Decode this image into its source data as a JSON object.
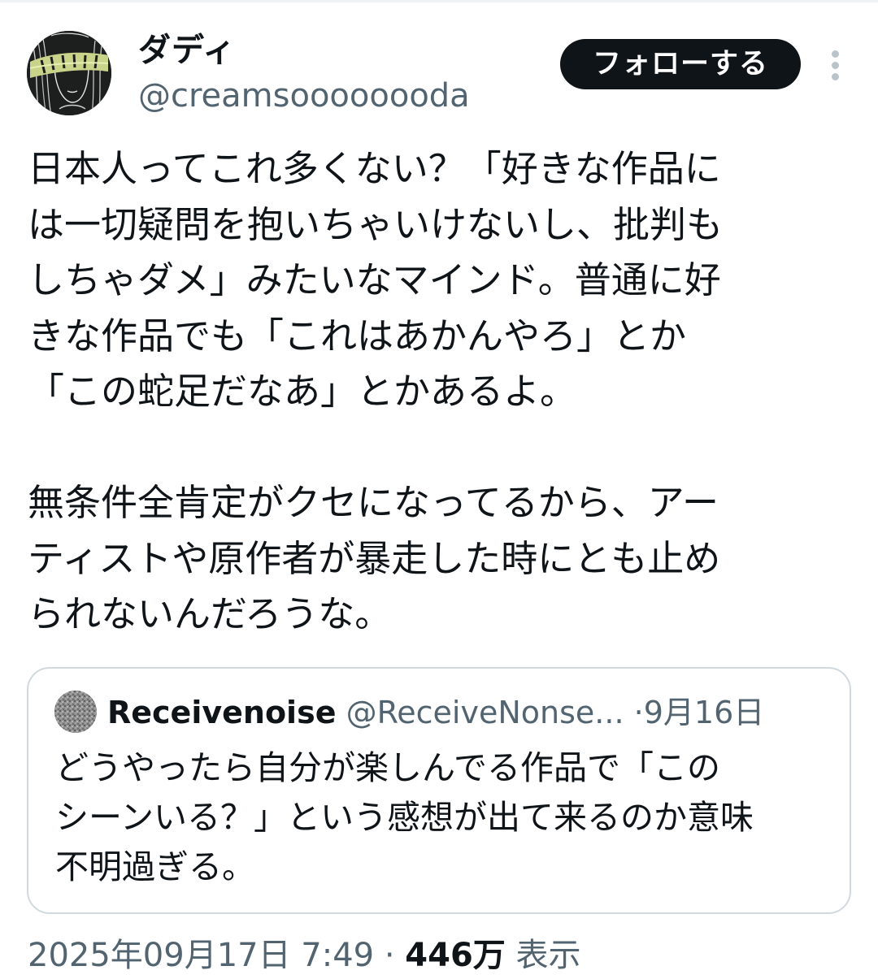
{
  "tweet": {
    "author": {
      "display_name": "ダディ",
      "handle": "@creamsoooooooda"
    },
    "follow_label": "フォローする",
    "more_icon": "more-vertical-icon",
    "text_lines": [
      "日本人ってこれ多くない？「好きな作品に",
      "は一切疑問を抱いちゃいけないし、批判も",
      "しちゃダメ」みたいなマインド。普通に好",
      "きな作品でも「これはあかんやろ」とか",
      "「この蛇足だなあ」とかあるよ。",
      "",
      "無条件全肯定がクセになってるから、アー",
      "ティストや原作者が暴走した時にとも止め",
      "られないんだろうな。"
    ],
    "quote": {
      "display_name": "Receivenoise",
      "handle": "@ReceiveNonse...",
      "separator": "·",
      "date": "9月16日",
      "text_lines": [
        "どうやったら自分が楽しんでる作品で「この",
        "シーンいる？」という感想が出て来るのか意味",
        "不明過ぎる。"
      ]
    },
    "meta": {
      "timestamp": "2025年09月17日 7:49",
      "separator": "·",
      "views_count": "446万",
      "views_label": "表示"
    }
  },
  "colors": {
    "text_primary": "#0f1419",
    "text_secondary": "#536471",
    "border": "#cfd9de",
    "follow_button_bg": "#0f1419",
    "follow_button_text": "#ffffff"
  }
}
